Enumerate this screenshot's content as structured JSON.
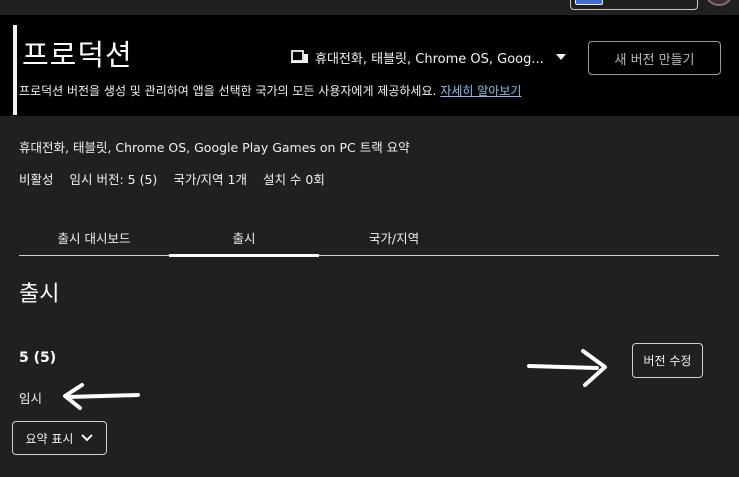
{
  "header": {
    "title": "프로덕션",
    "track_selector_label": "휴대전화, 태블릿, Chrome OS, Goog...",
    "track_selector_icon": "devices-icon",
    "new_version_button": "새 버전 만들기",
    "description": "프로덕션 버전을 생성 및 관리하여 앱을 선택한 국가의 모든 사용자에게 제공하세요.",
    "learn_more_link": "자세히 알아보기"
  },
  "summary": {
    "title": "휴대전화, 태블릿, Chrome OS, Google Play Games on PC 트랙 요약",
    "stats": [
      "비활성",
      "임시 버전: 5 (5)",
      "국가/지역 1개",
      "설치 수 0회"
    ]
  },
  "tabs": [
    {
      "label": "출시 대시보드",
      "selected": false
    },
    {
      "label": "출시",
      "selected": true
    },
    {
      "label": "국가/지역",
      "selected": false
    }
  ],
  "section": {
    "title": "출시",
    "release_name": "5 (5)",
    "release_status": "임시",
    "edit_button": "버전 수정",
    "summary_toggle_button": "요약 표시"
  },
  "colors": {
    "background": "#202020",
    "header_background": "#000000",
    "link": "#7ec3ea",
    "text": "#f1f1f1"
  }
}
